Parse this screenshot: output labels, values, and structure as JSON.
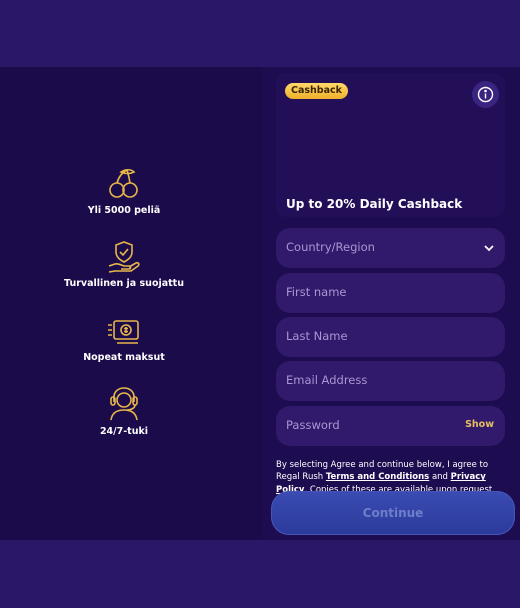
{
  "features": [
    {
      "label": "Yli 5000 peliä",
      "icon": "cherries-icon"
    },
    {
      "label": "Turvallinen ja suojattu",
      "icon": "shield-hand-icon"
    },
    {
      "label": "Nopeat maksut",
      "icon": "fast-money-icon"
    },
    {
      "label": "24/7-tuki",
      "icon": "support-headset-icon"
    }
  ],
  "promo": {
    "badge": "Cashback",
    "title": "Up to 20% Daily Cashback",
    "info_icon": "info-icon"
  },
  "form": {
    "country_placeholder": "Country/Region",
    "first_name_placeholder": "First name",
    "last_name_placeholder": "Last Name",
    "email_placeholder": "Email Address",
    "password_placeholder": "Password",
    "password_show": "Show",
    "terms_prefix": "By selecting Agree and continue below, I agree to Regal Rush ",
    "terms_link": "Terms and Conditions",
    "terms_and": " and ",
    "privacy_link": "Privacy Policy",
    "terms_suffix": ". Copies of these are available upon request.",
    "continue_label": "Continue"
  },
  "colors": {
    "page_bg": "#2a1767",
    "panel_bg": "#1c0b4a",
    "field_bg": "#31196b",
    "accent_gold": "#e6c063",
    "continue_bg": "#3a4bb3"
  }
}
